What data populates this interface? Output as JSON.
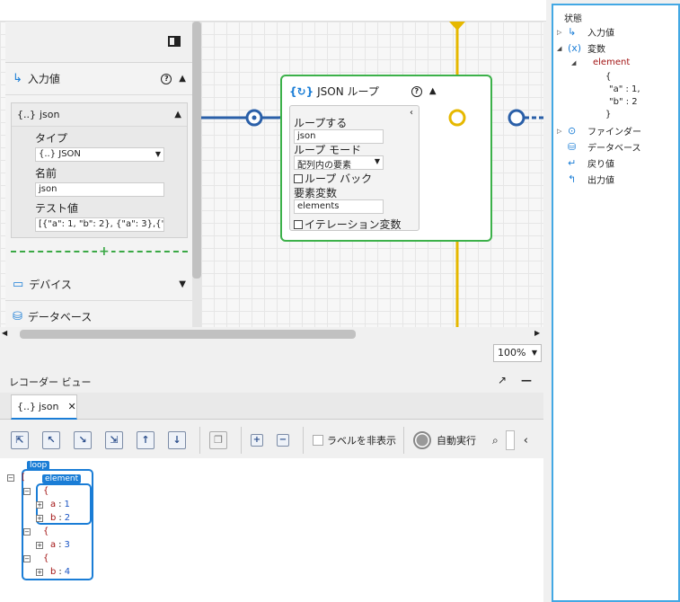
{
  "left_panel": {
    "section_input": "入力値",
    "json_header": "json",
    "json_icon": "{..}",
    "type_label": "タイプ",
    "type_value": "{..} JSON",
    "name_label": "名前",
    "name_value": "json",
    "test_label": "テスト値",
    "test_value": "[{\"a\": 1, \"b\": 2}, {\"a\": 3},{\"b…",
    "section_device": "デバイス",
    "section_database": "データベース"
  },
  "node": {
    "title": "JSON ループ",
    "loop_label": "ループする",
    "loop_value": "json",
    "mode_label": "ループ モード",
    "mode_value": "配列内の要素",
    "loopback_label": "ループ バック",
    "element_var_label": "要素変数",
    "element_var_value": "elements",
    "iter_var_label": "イテレーション変数"
  },
  "zoom": "100%",
  "recorder": {
    "title": "レコーダー ビュー",
    "tab_icon": "{..}",
    "tab_label": "json",
    "hide_labels": "ラベルを非表示",
    "auto_run": "自動実行"
  },
  "tree": {
    "loop_badge": "loop",
    "element_badge": "element",
    "open_bracket": "[",
    "open_brace": "{",
    "a_key": "a",
    "b_key": "b",
    "a1": "1",
    "b1": "2",
    "a2": "3",
    "b2": "4"
  },
  "right_panel": {
    "state": "状態",
    "input": "入力値",
    "variables": "変数",
    "element": "element",
    "json_line1": "{",
    "json_line2": "\"a\" : 1,",
    "json_line3": "\"b\" : 2",
    "json_line4": "}",
    "finder": "ファインダー",
    "database": "データベース",
    "return_value": "戻り値",
    "output": "出力値"
  },
  "colors": {
    "accent_blue": "#1a7dd6",
    "node_green": "#3cb14a",
    "flow_blue": "#2a5fa8",
    "yellow_line": "#e6b800",
    "key_red": "#a31515"
  }
}
